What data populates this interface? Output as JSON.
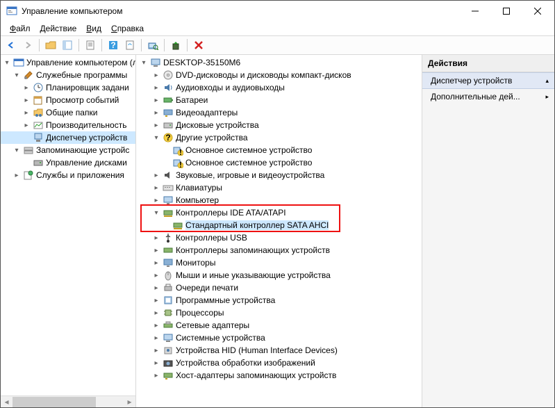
{
  "window": {
    "title": "Управление компьютером"
  },
  "menus": {
    "file": "Файл",
    "action": "Действие",
    "view": "Вид",
    "help": "Справка"
  },
  "left_tree": {
    "root": "Управление компьютером (л",
    "sys_tools": "Служебные программы",
    "task_sched": "Планировщик задани",
    "event_viewer": "Просмотр событий",
    "shared_folders": "Общие папки",
    "perf": "Производительность",
    "dev_mgr": "Диспетчер устройств",
    "storage": "Запоминающие устройс",
    "disk_mgmt": "Управление дисками",
    "services": "Службы и приложения"
  },
  "center_tree": {
    "root": "DESKTOP-35150M6",
    "dvd": "DVD-дисководы и дисководы компакт-дисков",
    "audio": "Аудиовходы и аудиовыходы",
    "battery": "Батареи",
    "video_adapt": "Видеоадаптеры",
    "disk": "Дисковые устройства",
    "other": "Другие устройства",
    "other_sys1": "Основное системное устройство",
    "other_sys2": "Основное системное устройство",
    "sound": "Звуковые, игровые и видеоустройства",
    "keyboard": "Клавиатуры",
    "computer": "Компьютер",
    "ide": "Контроллеры IDE ATA/ATAPI",
    "ide_sata": "Стандартный контроллер SATA AHCI",
    "usb": "Контроллеры USB",
    "storage_ctrl": "Контроллеры запоминающих устройств",
    "monitors": "Мониторы",
    "mice": "Мыши и иные указывающие устройства",
    "print_queue": "Очереди печати",
    "sw_devices": "Программные устройства",
    "cpu": "Процессоры",
    "net": "Сетевые адаптеры",
    "sys_dev": "Системные устройства",
    "hid": "Устройства HID (Human Interface Devices)",
    "imaging": "Устройства обработки изображений",
    "host_storage": "Хост-адаптеры запоминающих устройств"
  },
  "actions": {
    "title": "Действия",
    "dev_mgr": "Диспетчер устройств",
    "more": "Дополнительные дей..."
  }
}
